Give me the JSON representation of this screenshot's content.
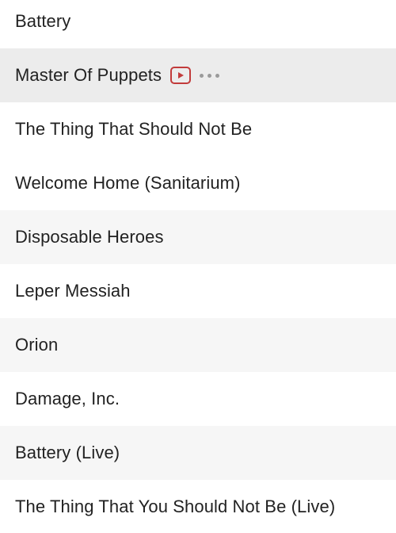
{
  "tracks": [
    {
      "title": "Battery",
      "shaded": false
    },
    {
      "title": "Master Of Puppets",
      "shaded": true,
      "hovered": true,
      "has_video": true,
      "video_icon": "play-video-icon",
      "more_icon": "ellipsis-icon"
    },
    {
      "title": "The Thing That Should Not Be",
      "shaded": false
    },
    {
      "title": "Welcome Home (Sanitarium)",
      "shaded": false
    },
    {
      "title": "Disposable Heroes",
      "shaded": true
    },
    {
      "title": "Leper Messiah",
      "shaded": false
    },
    {
      "title": "Orion",
      "shaded": true
    },
    {
      "title": "Damage, Inc.",
      "shaded": false
    },
    {
      "title": "Battery (Live)",
      "shaded": true
    },
    {
      "title": "The Thing That You Should Not Be (Live)",
      "shaded": false
    }
  ],
  "colors": {
    "text": "#222222",
    "row_alt": "#f6f6f6",
    "row_hover": "#ececec",
    "accent": "#c23b3b",
    "more_dots": "#9a9a9a"
  }
}
